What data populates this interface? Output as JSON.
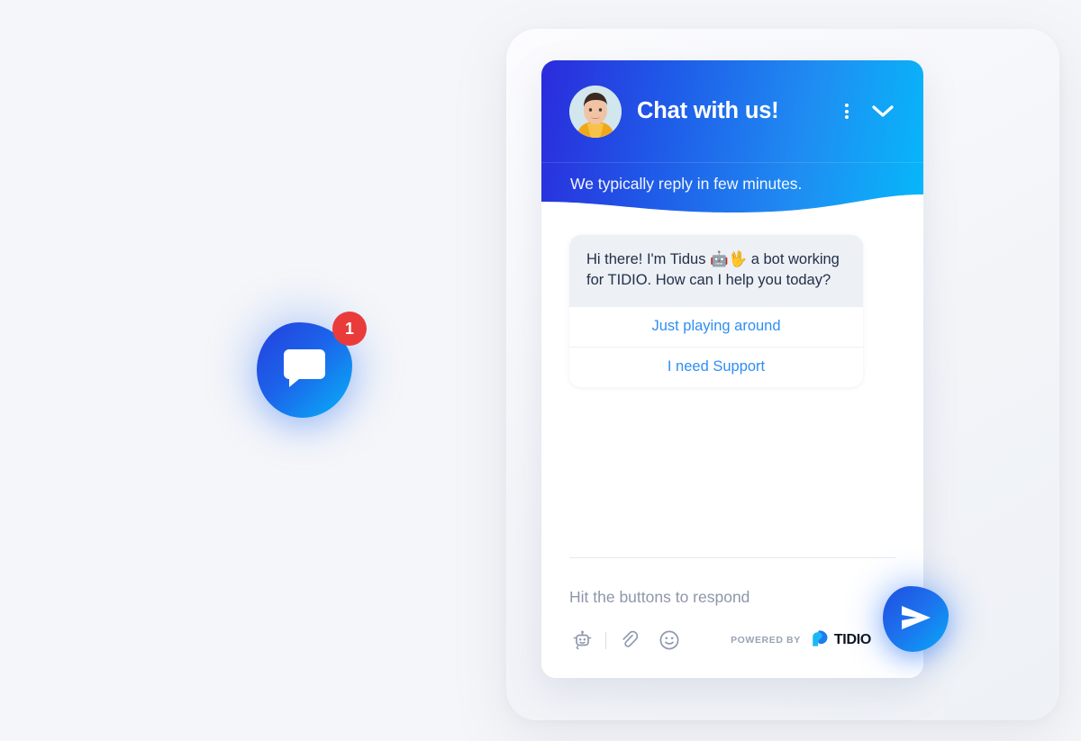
{
  "background_color": "#f5f6f9",
  "accent_color": "#1f6fed",
  "launcher": {
    "icon": "chat-bubble-icon",
    "unread_count": "1",
    "badge_color": "#ea3b3b"
  },
  "widget": {
    "header": {
      "title": "Chat with us!",
      "subtitle": "We typically reply in few minutes.",
      "avatar_icon": "agent-avatar-photo",
      "menu_icon": "more-vertical-icon",
      "collapse_icon": "chevron-down-icon",
      "gradient_from": "#2b2bdc",
      "gradient_to": "#06b8fa"
    },
    "conversation": {
      "bot_message": "Hi there! I'm Tidus 🤖🖖 a bot working for TIDIO. How can I help you today?",
      "quick_replies": [
        {
          "label": "Just playing around"
        },
        {
          "label": "I need Support"
        }
      ]
    },
    "composer": {
      "placeholder": "Hit the buttons to respond",
      "value": "",
      "tools": [
        {
          "name": "chatbot-icon"
        },
        {
          "name": "paperclip-icon"
        },
        {
          "name": "emoji-icon"
        }
      ],
      "send_icon": "send-icon",
      "powered_by_label": "POWERED BY",
      "brand_name": "TIDIO"
    }
  }
}
